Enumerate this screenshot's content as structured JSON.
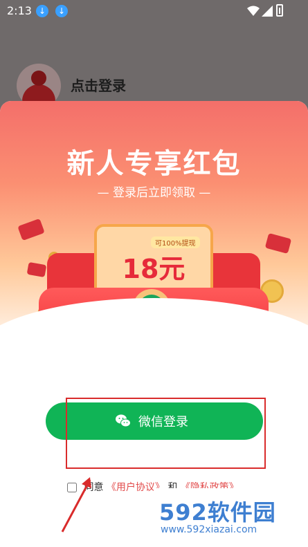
{
  "status_bar": {
    "time": "2:13"
  },
  "profile": {
    "login_prompt": "点击登录"
  },
  "promo": {
    "title": "新人专享红包",
    "subtitle": "— 登录后立即领取 —",
    "badge": "可100%提现",
    "amount": "18元"
  },
  "actions": {
    "wechat_login_label": "微信登录"
  },
  "agreement": {
    "prefix": "同意",
    "user_agreement": "《用户协议》",
    "and": "和",
    "privacy_policy": "《隐私政策》"
  },
  "watermark": {
    "brand": "592软件园",
    "url": "www.592xiazai.com"
  },
  "colors": {
    "wechat_green": "#10b456",
    "accent_red": "#e62a3a",
    "annotation_red": "#d92b2b"
  }
}
